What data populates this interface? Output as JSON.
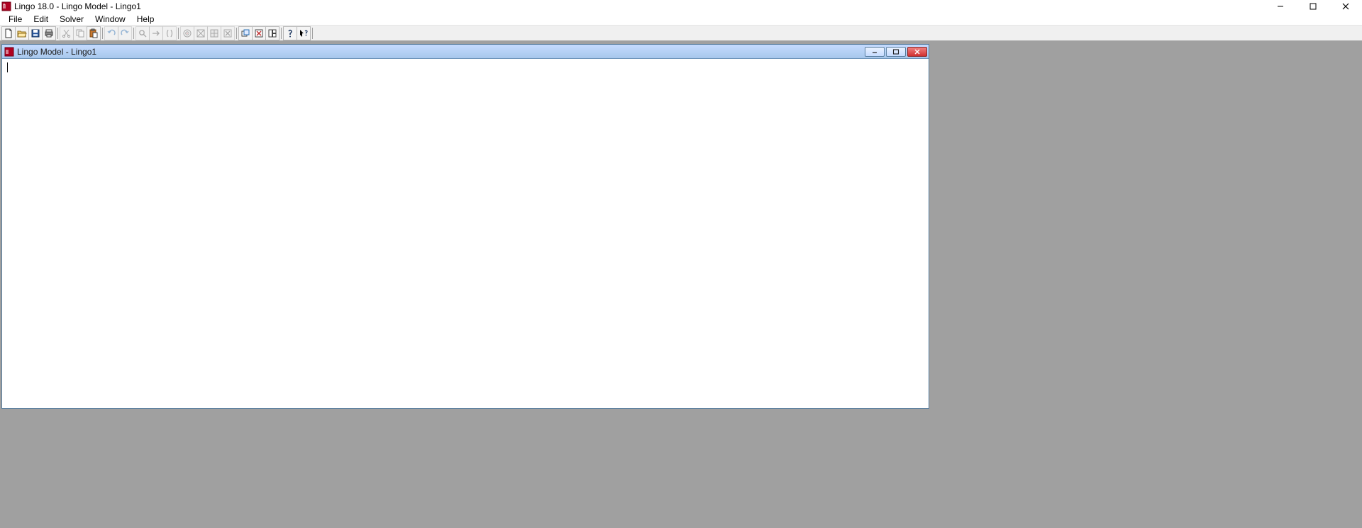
{
  "app": {
    "title": "Lingo 18.0 - Lingo Model - Lingo1"
  },
  "menu": {
    "file": "File",
    "edit": "Edit",
    "solver": "Solver",
    "window": "Window",
    "help": "Help"
  },
  "toolbar": {
    "group1": [
      {
        "name": "new",
        "disabled": false
      },
      {
        "name": "open",
        "disabled": false
      },
      {
        "name": "save",
        "disabled": false
      },
      {
        "name": "print",
        "disabled": false
      }
    ],
    "group2": [
      {
        "name": "cut",
        "disabled": true
      },
      {
        "name": "copy",
        "disabled": true
      },
      {
        "name": "paste",
        "disabled": false
      }
    ],
    "group3": [
      {
        "name": "undo",
        "disabled": true
      },
      {
        "name": "redo",
        "disabled": true
      }
    ],
    "group4": [
      {
        "name": "find",
        "disabled": true
      },
      {
        "name": "goto",
        "disabled": true
      },
      {
        "name": "paren",
        "disabled": true
      }
    ],
    "group5": [
      {
        "name": "solve",
        "disabled": true
      },
      {
        "name": "solution",
        "disabled": true
      },
      {
        "name": "matrix",
        "disabled": true
      },
      {
        "name": "options",
        "disabled": true
      }
    ],
    "group6": [
      {
        "name": "picture",
        "disabled": false
      },
      {
        "name": "debug",
        "disabled": false
      },
      {
        "name": "generate",
        "disabled": false
      }
    ],
    "group7": [
      {
        "name": "help",
        "disabled": false
      },
      {
        "name": "context-help",
        "disabled": false
      }
    ]
  },
  "child": {
    "title": "Lingo Model - Lingo1"
  }
}
